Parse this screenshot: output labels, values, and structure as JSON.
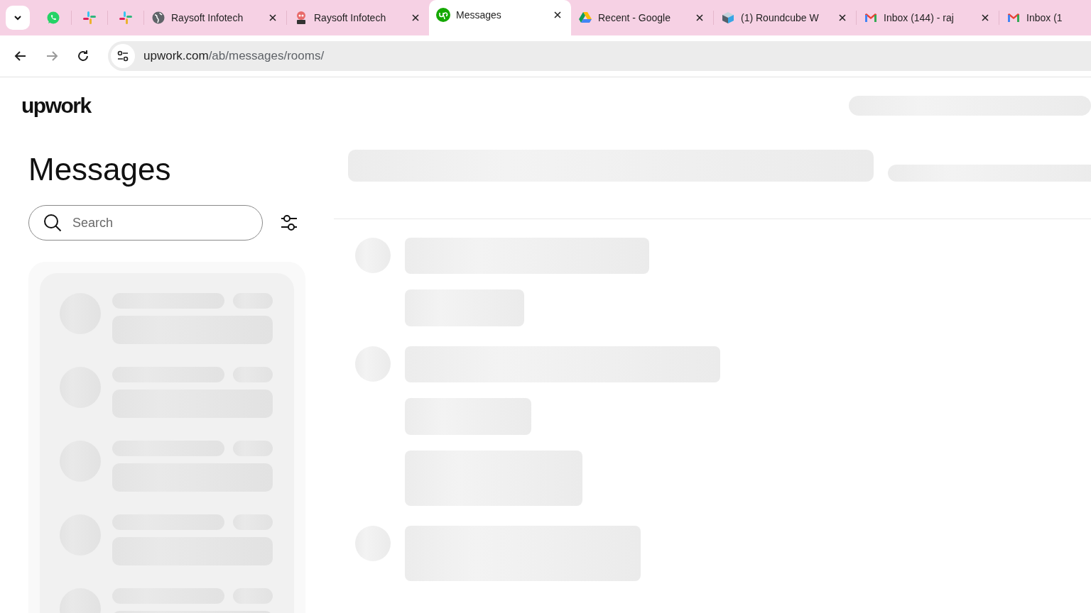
{
  "tabs": [
    {
      "kind": "whatsapp",
      "selected": false
    },
    {
      "kind": "slack",
      "selected": false
    },
    {
      "kind": "slack",
      "selected": false
    },
    {
      "kind": "globe",
      "title": "Raysoft Infotech",
      "selected": false
    },
    {
      "kind": "mascot",
      "title": "Raysoft Infotech",
      "selected": false
    },
    {
      "kind": "upwork",
      "title": "Messages",
      "selected": true
    },
    {
      "kind": "drive",
      "title": "Recent - Google",
      "selected": false
    },
    {
      "kind": "roundcube",
      "title": "(1) Roundcube W",
      "selected": false
    },
    {
      "kind": "gmail",
      "title": "Inbox (144) - raj",
      "selected": false
    },
    {
      "kind": "gmail",
      "title": "Inbox (1",
      "selected": false
    }
  ],
  "address_bar": {
    "domain": "upwork.com",
    "path": "/ab/messages/rooms/"
  },
  "logo": "upwork",
  "title": "Messages",
  "search": {
    "placeholder": "Search"
  }
}
